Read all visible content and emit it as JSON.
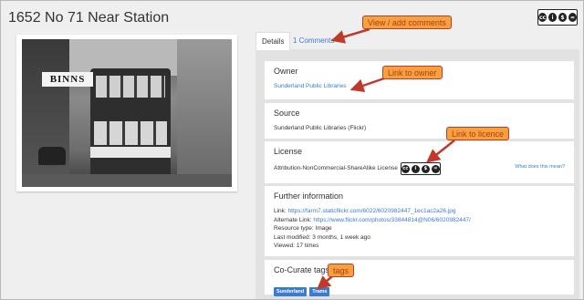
{
  "page": {
    "title": "1652 No 71 Near Station"
  },
  "photo": {
    "sign_text": "BINNS"
  },
  "tabs": [
    {
      "label": "Details"
    },
    {
      "label": "1 Comments"
    }
  ],
  "owner": {
    "heading": "Owner",
    "value": "Sunderland Public Libraries"
  },
  "source": {
    "heading": "Source",
    "value": "Sunderland Public Libraries (Flickr)"
  },
  "license": {
    "heading": "License",
    "value": "Attribution-NonCommercial-ShareAlike License",
    "help_link": "What does this mean?"
  },
  "further": {
    "heading": "Further information",
    "link_label": "Link:",
    "link_url": "https://farm7.staticflickr.com/6022/6020982447_1ec1ac2a26.jpg",
    "alt_label": "Alternate Link:",
    "alt_url": "https://www.flickr.com/photos/33844814@N06/6020982447/",
    "resource_type": "Resource type: Image",
    "last_modified": "Last modified: 3 months, 1 week ago",
    "viewed": "Viewed: 17 times"
  },
  "tags": {
    "heading": "Co-Curate tags",
    "items": [
      "Sunderland",
      "Trams"
    ]
  },
  "callouts": {
    "comments": "View / add comments",
    "owner": "Link to owner",
    "licence": "Link to licence",
    "tags": "tags"
  },
  "icons": {
    "cc_logo": "creative-commons-icon",
    "license_badge": "cc-by-nc-sa-icon"
  },
  "colors": {
    "link": "#3a7bd5",
    "callout_fill": "#f6a13d",
    "callout_border": "#c0392b",
    "tag_bg": "#3a7bd5"
  }
}
